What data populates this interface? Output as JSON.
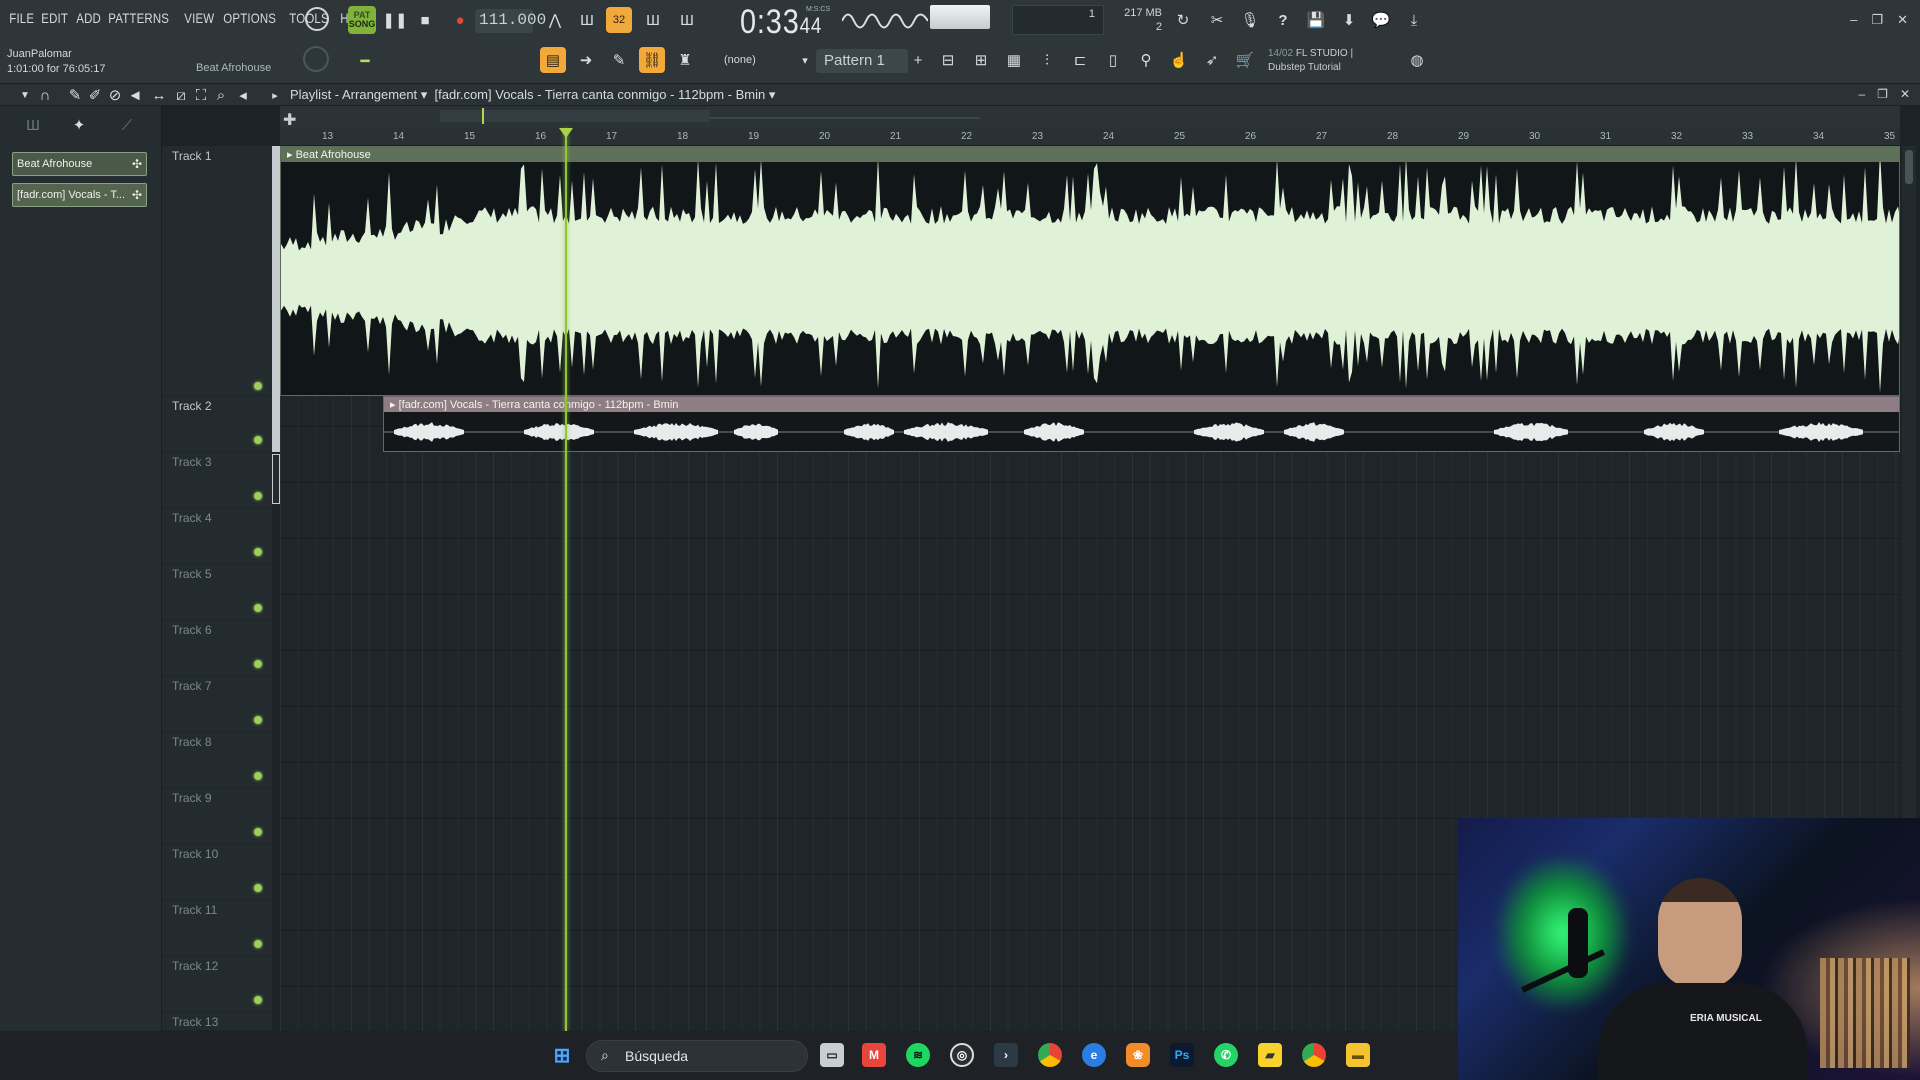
{
  "menu": [
    "FILE",
    "EDIT",
    "ADD",
    "PATTERNS",
    "VIEW",
    "OPTIONS",
    "TOOLS",
    "HELP"
  ],
  "transport": {
    "mode_top": "PAT",
    "mode_bottom": "SONG",
    "tempo": "111.000",
    "time_main": "0:33",
    "time_sub": "44",
    "time_format": "M:S:CS"
  },
  "monitor": {
    "polyphony": "1",
    "memory": "217 MB",
    "cpu_cores": "2"
  },
  "hint": {
    "user": "JuanPalomar",
    "time": "1:01:00 for 76:05:17",
    "project": "Beat Afrohouse"
  },
  "toolbar2": {
    "snap_value": "(none)",
    "pattern_name": "Pattern 1"
  },
  "news": {
    "date": "14/02",
    "line1": "FL STUDIO |",
    "line2": "Dubstep Tutorial"
  },
  "playlist": {
    "title_prefix": "Playlist - Arrangement",
    "title_clip": "[fadr.com] Vocals - Tierra canta conmigo - 112bpm - Bmin"
  },
  "picker": {
    "items": [
      "Beat Afrohouse",
      "[fadr.com] Vocals - T..."
    ]
  },
  "ruler": {
    "bars": [
      "13",
      "14",
      "15",
      "16",
      "17",
      "18",
      "19",
      "20",
      "21",
      "22",
      "23",
      "24",
      "25",
      "26",
      "27",
      "28",
      "29",
      "30",
      "31",
      "32",
      "33",
      "34",
      "35"
    ]
  },
  "tracks": [
    "Track 1",
    "Track 2",
    "Track 3",
    "Track 4",
    "Track 5",
    "Track 6",
    "Track 7",
    "Track 8",
    "Track 9",
    "Track 10",
    "Track 11",
    "Track 12",
    "Track 13"
  ],
  "clips": {
    "beat": "Beat Afrohouse",
    "vocals": "[fadr.com] Vocals - Tierra canta conmigo - 112bpm - Bmin"
  },
  "webcam": {
    "shirt_text": "ERIA MUSICAL"
  },
  "taskbar": {
    "search_label": "Búsqueda",
    "apps": [
      "start-icon",
      "file-manager-icon",
      "gmail-icon",
      "spotify-icon",
      "steam-icon",
      "terminal-icon",
      "chrome-icon",
      "edge-icon",
      "fl-studio-icon",
      "photoshop-icon",
      "whatsapp-icon",
      "sticky-notes-icon",
      "chrome-profile-icon",
      "folder-icon"
    ]
  },
  "colors": {
    "accent_orange": "#f2a93b",
    "accent_green": "#8fc43b",
    "clip_beat": "#dff2d8",
    "clip_vocal": "#8e7d82"
  }
}
